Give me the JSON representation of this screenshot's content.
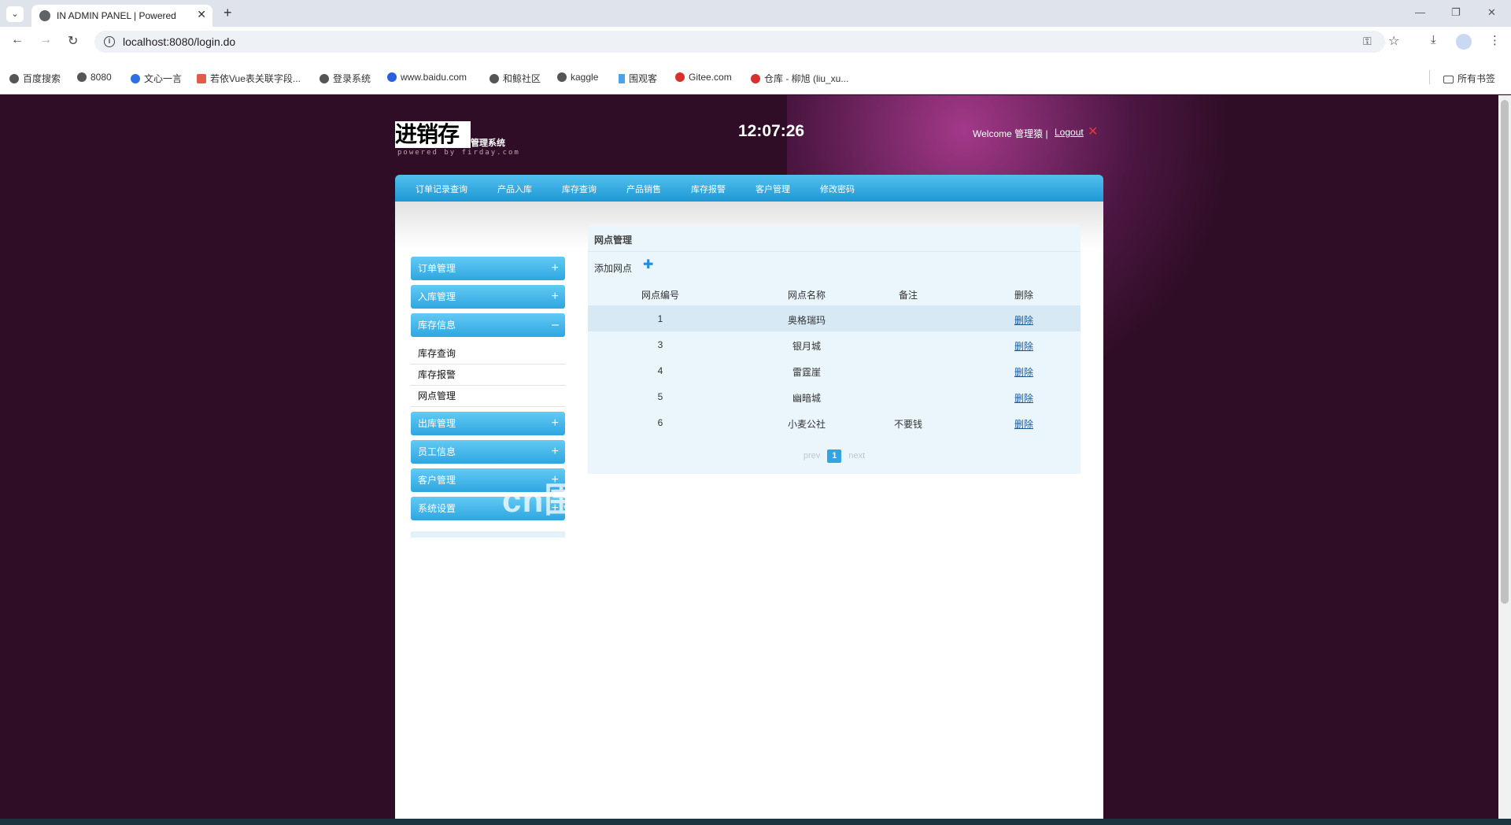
{
  "browser": {
    "tab_title": "IN ADMIN PANEL | Powered",
    "url": "localhost:8080/login.do",
    "bookmarks": [
      "百度搜索",
      "8080",
      "文心一言",
      "若依Vue表关联字段...",
      "登录系统",
      "www.baidu.com",
      "和鲸社区",
      "kaggle",
      "围观客",
      "Gitee.com",
      "仓库 - 柳旭 (liu_xu..."
    ],
    "all_bookmarks": "所有书签"
  },
  "header": {
    "logo_main": "进销存",
    "logo_sub": "管理系统",
    "logo_powered": "powered by firday.com",
    "clock": "12:07:26",
    "welcome": "Welcome 管理猿 |",
    "logout": "Logout"
  },
  "topnav": [
    "订单记录查询",
    "产品入库",
    "库存查询",
    "产品销售",
    "库存报警",
    "客户管理",
    "修改密码"
  ],
  "sidebar": {
    "sections": [
      {
        "label": "订单管理",
        "sign": "+"
      },
      {
        "label": "入库管理",
        "sign": "+"
      },
      {
        "label": "库存信息",
        "sign": "–",
        "items": [
          "库存查询",
          "库存报警",
          "网点管理"
        ]
      },
      {
        "label": "出库管理",
        "sign": "+"
      },
      {
        "label": "员工信息",
        "sign": "+"
      },
      {
        "label": "客户管理",
        "sign": "+"
      },
      {
        "label": "系统设置",
        "sign": "+"
      }
    ]
  },
  "content": {
    "title": "网点管理",
    "add_label": "添加网点",
    "table": {
      "headers": [
        "网点编号",
        "网点名称",
        "备注",
        "删除"
      ],
      "rows": [
        {
          "id": "1",
          "name": "奥格瑞玛",
          "note": "",
          "action": "删除"
        },
        {
          "id": "3",
          "name": "银月城",
          "note": "",
          "action": "删除"
        },
        {
          "id": "4",
          "name": "雷霆崖",
          "note": "",
          "action": "删除"
        },
        {
          "id": "5",
          "name": "幽暗城",
          "note": "",
          "action": "删除"
        },
        {
          "id": "6",
          "name": "小麦公社",
          "note": "不要钱",
          "action": "删除"
        }
      ]
    },
    "pager": {
      "prev": "prev",
      "current": "1",
      "next": "next"
    }
  },
  "watermark": "cn围观客www.weiguanke.cn",
  "colors": {
    "page_bg": "#2f0d26",
    "nav_blue": "#2fa6e0",
    "content_bg": "#ebf6fc",
    "logout_x": "#e8373a"
  }
}
